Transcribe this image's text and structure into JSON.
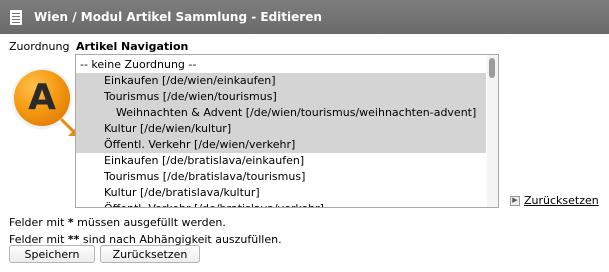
{
  "window": {
    "title": "Wien / Modul Artikel Sammlung - Editieren"
  },
  "form": {
    "field_label": "Zuordnung",
    "section_label": "Artikel Navigation",
    "badge_letter": "A",
    "list_items": [
      {
        "label": "-- keine Zuordnung --",
        "level": 0,
        "selected": false
      },
      {
        "label": "Einkaufen [/de/wien/einkaufen]",
        "level": 1,
        "selected": true
      },
      {
        "label": "Tourismus [/de/wien/tourismus]",
        "level": 1,
        "selected": true
      },
      {
        "label": "Weihnachten & Advent [/de/wien/tourismus/weihnachten-advent]",
        "level": 2,
        "selected": true
      },
      {
        "label": "Kultur [/de/wien/kultur]",
        "level": 1,
        "selected": true
      },
      {
        "label": "Öffentl. Verkehr [/de/wien/verkehr]",
        "level": 1,
        "selected": true
      },
      {
        "label": "Einkaufen [/de/bratislava/einkaufen]",
        "level": 1,
        "selected": false
      },
      {
        "label": "Tourismus [/de/bratislava/tourismus]",
        "level": 1,
        "selected": false
      },
      {
        "label": "Kultur [/de/bratislava/kultur]",
        "level": 1,
        "selected": false
      },
      {
        "label": "Öffentl. Verkehr [/de/bratislava/verkehr]",
        "level": 1,
        "selected": false
      }
    ],
    "reset_link": "Zurücksetzen",
    "note_required": "Felder mit * müssen ausgefüllt werden.",
    "note_dependent": "Felder mit ** sind nach Abhängigkeit auszufüllen."
  },
  "buttons": {
    "save": "Speichern",
    "reset": "Zurücksetzen"
  },
  "colors": {
    "titlebar": "#737373",
    "selected_row": "#d4d4d4",
    "badge": "#f59a12"
  }
}
